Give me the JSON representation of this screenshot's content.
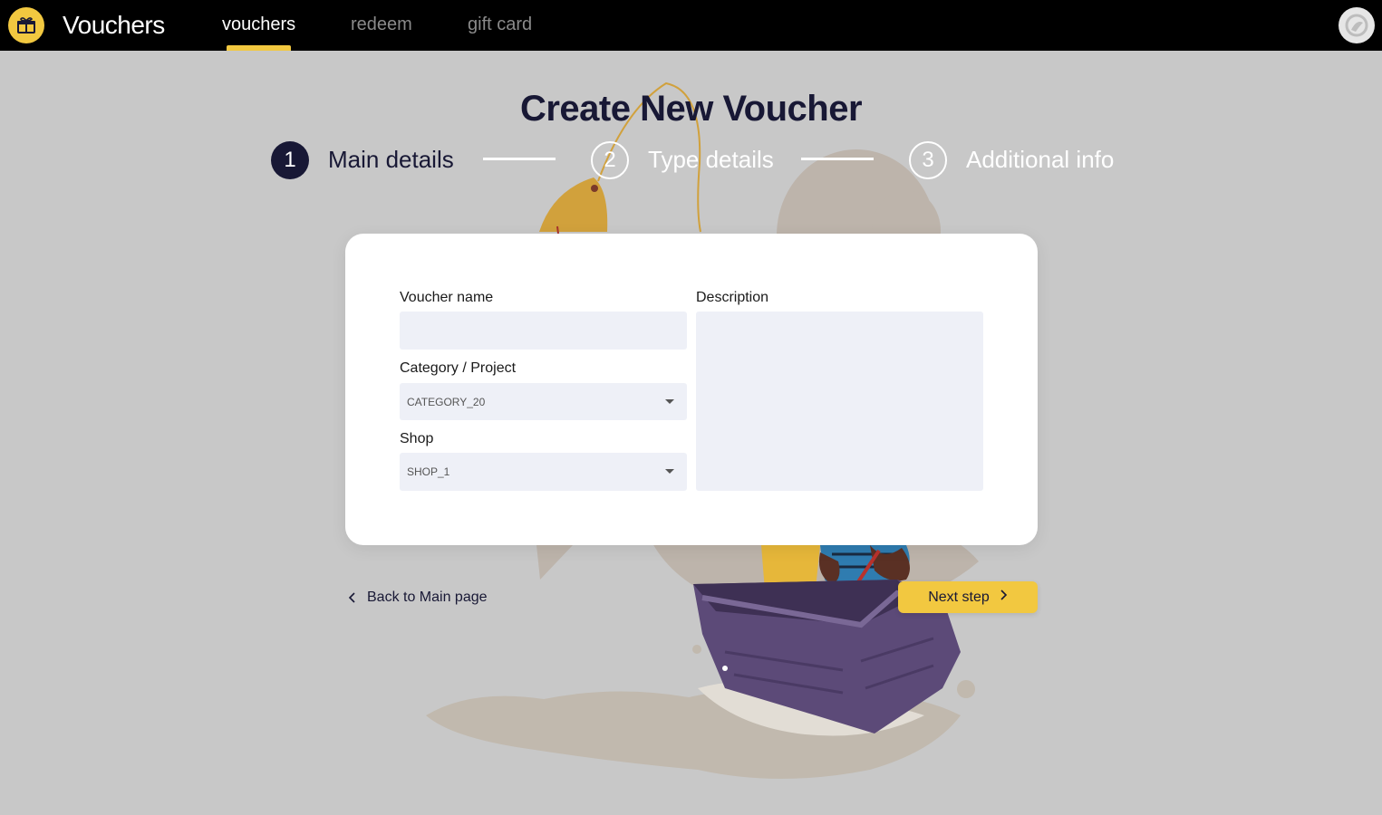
{
  "header": {
    "app_title": "Vouchers",
    "tabs": [
      {
        "label": "vouchers",
        "active": true
      },
      {
        "label": "redeem",
        "active": false
      },
      {
        "label": "gift card",
        "active": false
      }
    ],
    "logo_icon": "gift-box-icon",
    "avatar_icon": "user-avatar-icon"
  },
  "page": {
    "title": "Create New Voucher"
  },
  "stepper": {
    "steps": [
      {
        "number": "1",
        "label": "Main details",
        "active": true
      },
      {
        "number": "2",
        "label": "Type details",
        "active": false
      },
      {
        "number": "3",
        "label": "Additional info",
        "active": false
      }
    ]
  },
  "form": {
    "voucher_name": {
      "label": "Voucher name",
      "value": "",
      "placeholder": ""
    },
    "category": {
      "label": "Category / Project",
      "selected": "CATEGORY_20"
    },
    "shop": {
      "label": "Shop",
      "selected": "SHOP_1"
    },
    "description": {
      "label": "Description",
      "value": "",
      "placeholder": ""
    }
  },
  "actions": {
    "back_label": "Back to Main page",
    "next_label": "Next step"
  },
  "colors": {
    "accent": "#f2c840",
    "dark": "#181835",
    "background": "#c8c8c8",
    "field_bg": "#eef0f7"
  }
}
